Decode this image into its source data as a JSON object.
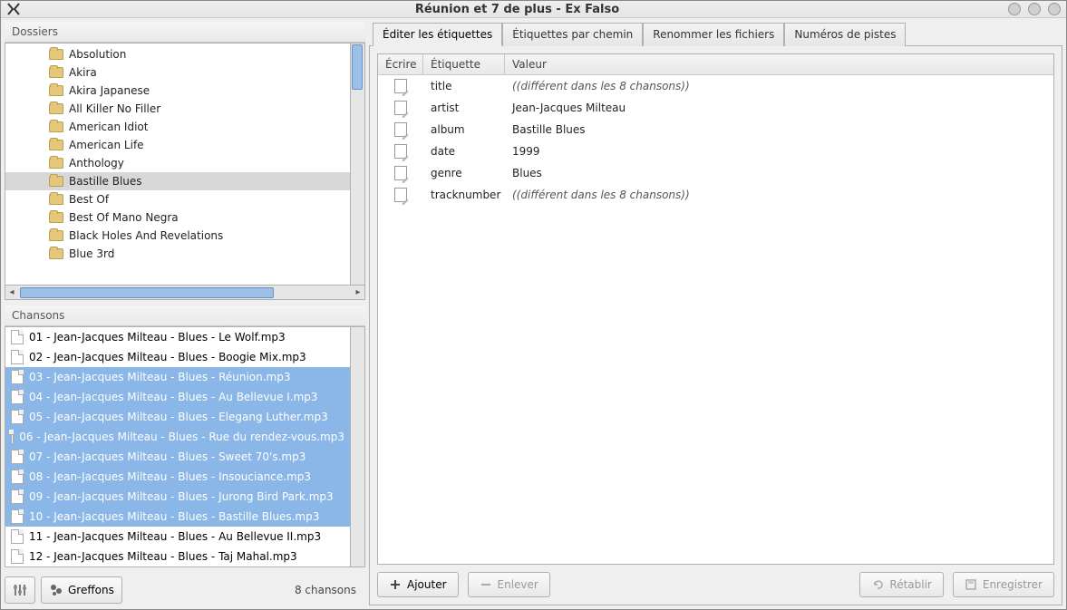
{
  "window": {
    "title": "Réunion et 7 de plus - Ex Falso"
  },
  "left": {
    "folders_header": "Dossiers",
    "songs_header": "Chansons",
    "folders": [
      {
        "name": "Absolution",
        "selected": false
      },
      {
        "name": "Akira",
        "selected": false
      },
      {
        "name": "Akira Japanese",
        "selected": false
      },
      {
        "name": "All Killer No Filler",
        "selected": false
      },
      {
        "name": "American Idiot",
        "selected": false
      },
      {
        "name": "American Life",
        "selected": false
      },
      {
        "name": "Anthology",
        "selected": false
      },
      {
        "name": "Bastille Blues",
        "selected": true
      },
      {
        "name": "Best Of",
        "selected": false
      },
      {
        "name": "Best Of Mano Negra",
        "selected": false
      },
      {
        "name": "Black Holes And Revelations",
        "selected": false
      },
      {
        "name": "Blue 3rd",
        "selected": false
      }
    ],
    "songs": [
      {
        "name": "01 - Jean-Jacques Milteau - Blues - Le Wolf.mp3",
        "selected": false
      },
      {
        "name": "02 - Jean-Jacques Milteau - Blues - Boogie Mix.mp3",
        "selected": false
      },
      {
        "name": "03 - Jean-Jacques Milteau - Blues - Réunion.mp3",
        "selected": true
      },
      {
        "name": "04 - Jean-Jacques Milteau - Blues - Au Bellevue I.mp3",
        "selected": true
      },
      {
        "name": "05 - Jean-Jacques Milteau - Blues - Elegang Luther.mp3",
        "selected": true
      },
      {
        "name": "06 - Jean-Jacques Milteau - Blues - Rue du rendez-vous.mp3",
        "selected": true
      },
      {
        "name": "07 - Jean-Jacques Milteau - Blues - Sweet 70's.mp3",
        "selected": true
      },
      {
        "name": "08 - Jean-Jacques Milteau - Blues - Insouciance.mp3",
        "selected": true
      },
      {
        "name": "09 - Jean-Jacques Milteau - Blues - Jurong Bird Park.mp3",
        "selected": true
      },
      {
        "name": "10 - Jean-Jacques Milteau - Blues - Bastille Blues.mp3",
        "selected": true
      },
      {
        "name": "11 - Jean-Jacques Milteau - Blues - Au Bellevue II.mp3",
        "selected": false
      },
      {
        "name": "12 - Jean-Jacques Milteau - Blues - Taj Mahal.mp3",
        "selected": false
      }
    ],
    "plugins_label": "Greffons",
    "status": "8 chansons"
  },
  "tabs": [
    {
      "label": "Éditer les étiquettes",
      "active": true
    },
    {
      "label": "Étiquettes par chemin",
      "active": false
    },
    {
      "label": "Renommer les fichiers",
      "active": false
    },
    {
      "label": "Numéros de pistes",
      "active": false
    }
  ],
  "tag_table": {
    "headers": {
      "ecrire": "Écrire",
      "etiquette": "Étiquette",
      "valeur": "Valeur"
    },
    "rows": [
      {
        "tag": "title",
        "value": "((différent dans les 8 chansons))",
        "italic": true
      },
      {
        "tag": "artist",
        "value": "Jean-Jacques Milteau",
        "italic": false
      },
      {
        "tag": "album",
        "value": "Bastille Blues",
        "italic": false
      },
      {
        "tag": "date",
        "value": "1999",
        "italic": false
      },
      {
        "tag": "genre",
        "value": "Blues",
        "italic": false
      },
      {
        "tag": "tracknumber",
        "value": "((différent dans les 8 chansons))",
        "italic": true
      }
    ]
  },
  "buttons": {
    "add": "Ajouter",
    "remove": "Enlever",
    "revert": "Rétablir",
    "save": "Enregistrer"
  }
}
